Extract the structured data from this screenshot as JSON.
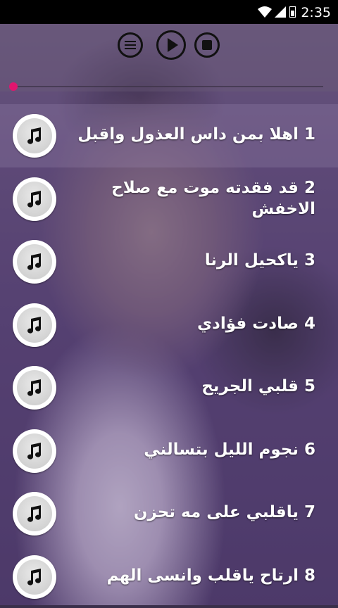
{
  "status_bar": {
    "time": "2:35"
  },
  "player": {
    "buttons": [
      "menu-icon",
      "play-icon",
      "stop-icon"
    ],
    "progress": 0
  },
  "songs": [
    {
      "label": "1 اهلا بمن داس العذول واقبل"
    },
    {
      "label": "2 قد فقدته موت مع صلاح الاخفش"
    },
    {
      "label": "3 ياكحيل الرنا"
    },
    {
      "label": "4 صادت فؤادي"
    },
    {
      "label": "5 قلبي الجريح"
    },
    {
      "label": "6 نجوم الليل بتسالني"
    },
    {
      "label": "7 ياقلبي على مه تحزن"
    },
    {
      "label": "8 ارتاح ياقلب وانسى الهم"
    }
  ],
  "colors": {
    "accent": "#e2156e",
    "overlay": "#624882"
  }
}
